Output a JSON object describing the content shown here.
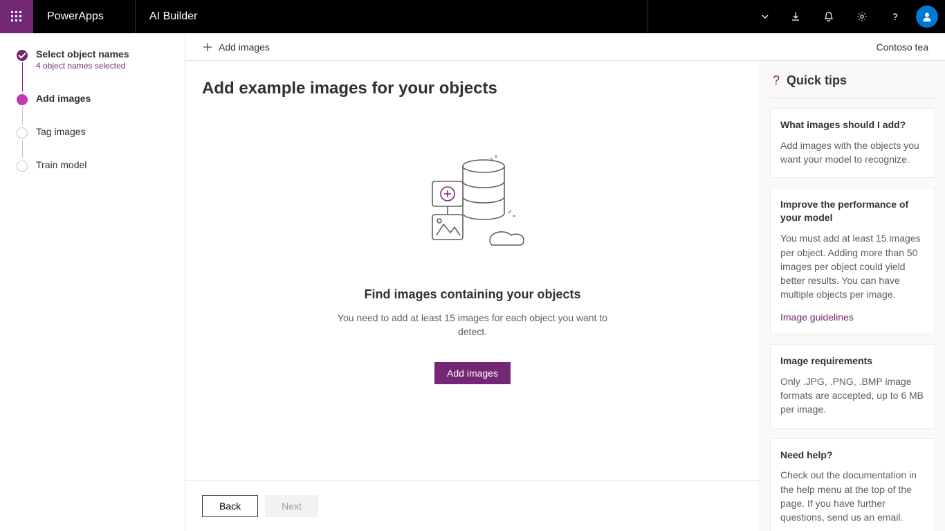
{
  "header": {
    "brand": "PowerApps",
    "section": "AI Builder"
  },
  "commandbar": {
    "add_images": "Add images",
    "context": "Contoso tea"
  },
  "steps": [
    {
      "title": "Select object names",
      "sub": "4 object names selected",
      "state": "done"
    },
    {
      "title": "Add images",
      "state": "current"
    },
    {
      "title": "Tag images",
      "state": "pending"
    },
    {
      "title": "Train model",
      "state": "pending"
    }
  ],
  "page": {
    "title": "Add example images for your objects",
    "hero_title": "Find images containing your objects",
    "hero_body": "You need to add at least 15 images for each object you want to detect.",
    "hero_button": "Add images",
    "back": "Back",
    "next": "Next"
  },
  "tips": {
    "header": "Quick tips",
    "cards": [
      {
        "title": "What images should I add?",
        "body": "Add images with the objects you want your model to recognize."
      },
      {
        "title": "Improve the performance of your model",
        "body": "You must add at least 15 images per object. Adding more than 50 images per object could yield better results. You can have multiple objects per image.",
        "link": "Image guidelines"
      },
      {
        "title": "Image requirements",
        "body": "Only .JPG, .PNG, .BMP image formats are accepted, up to 6 MB per image."
      },
      {
        "title": "Need help?",
        "body": "Check out the documentation in the help menu at the top of the page. If you have further questions, send us an email."
      }
    ]
  }
}
